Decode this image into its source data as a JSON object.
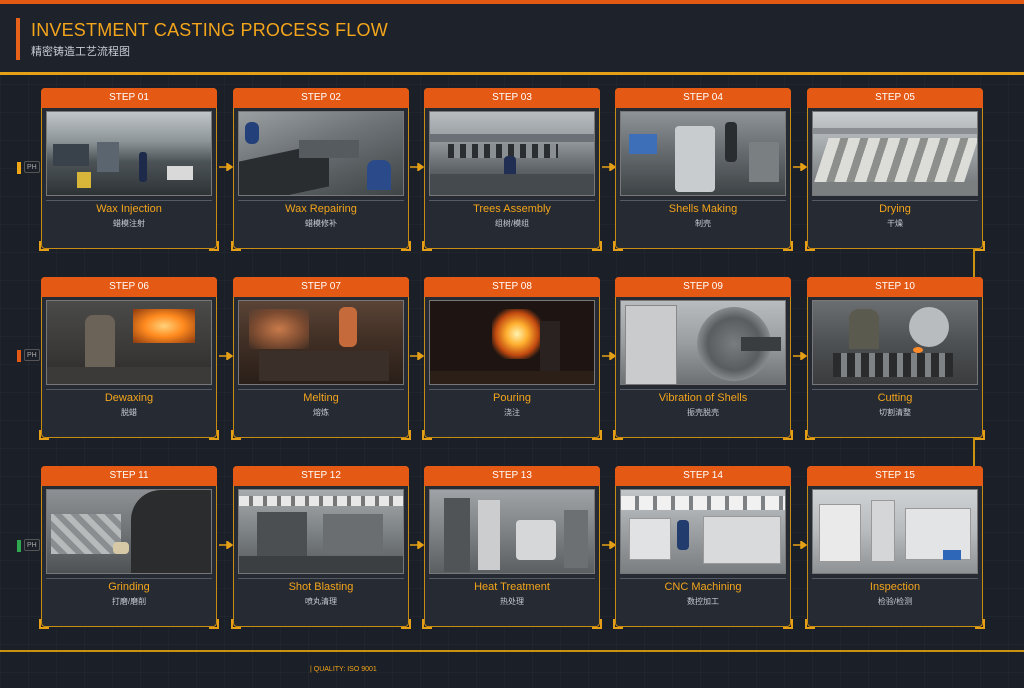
{
  "header": {
    "title": "INVESTMENT CASTING PROCESS FLOW",
    "subtitle": "精密铸造工艺流程图"
  },
  "footer": {
    "text": "| QUALITY: ISO 9001"
  },
  "phases": [
    {
      "label": "PH",
      "color": "#f0a615"
    },
    {
      "label": "PH",
      "color": "#e45914"
    },
    {
      "label": "PH",
      "color": "#2fa84f"
    }
  ],
  "steps": [
    {
      "step": "STEP 01",
      "name": "Wax Injection",
      "cn": "蜡模注射"
    },
    {
      "step": "STEP 02",
      "name": "Wax Repairing",
      "cn": "蜡模修补"
    },
    {
      "step": "STEP 03",
      "name": "Trees Assembly",
      "cn": "组树/模组"
    },
    {
      "step": "STEP 04",
      "name": "Shells Making",
      "cn": "制壳"
    },
    {
      "step": "STEP 05",
      "name": "Drying",
      "cn": "干燥"
    },
    {
      "step": "STEP 06",
      "name": "Dewaxing",
      "cn": "脱蜡"
    },
    {
      "step": "STEP 07",
      "name": "Melting",
      "cn": "熔炼"
    },
    {
      "step": "STEP 08",
      "name": "Pouring",
      "cn": "浇注"
    },
    {
      "step": "STEP 09",
      "name": "Vibration of Shells",
      "cn": "振壳脱壳"
    },
    {
      "step": "STEP 10",
      "name": "Cutting",
      "cn": "切割清整"
    },
    {
      "step": "STEP 11",
      "name": "Grinding",
      "cn": "打磨/磨削"
    },
    {
      "step": "STEP 12",
      "name": "Shot Blasting",
      "cn": "喷丸清理"
    },
    {
      "step": "STEP 13",
      "name": "Heat Treatment",
      "cn": "热处理"
    },
    {
      "step": "STEP 14",
      "name": "CNC Machining",
      "cn": "数控加工"
    },
    {
      "step": "STEP 15",
      "name": "Inspection",
      "cn": "检验/检测"
    }
  ],
  "colors": {
    "accent": "#f3a51b",
    "step_header": "#e45914",
    "card_border": "#c98c12",
    "background": "#1b1f27"
  }
}
